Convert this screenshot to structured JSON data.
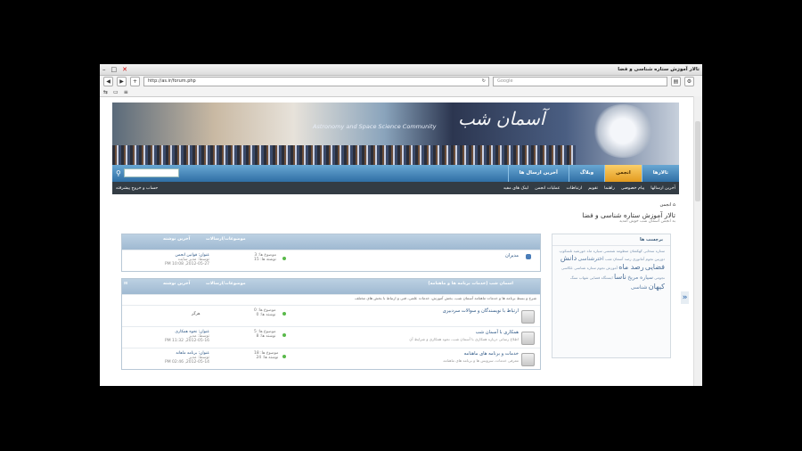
{
  "window": {
    "title": "تالار آموزش ستاره شناسی و فضا",
    "url": "http://as.ir/forum.php",
    "search_placeholder": "Google"
  },
  "banner": {
    "english_title": "Astronomy and Space Science Community",
    "logo_text": "آسمان شب"
  },
  "nav": {
    "tabs": [
      "تالارها",
      "انجمن",
      "وبلاگ",
      "آخرین ارسال ها"
    ],
    "active_tab": "انجمن",
    "submenu": [
      "آخرین ارسالها",
      "پیام خصوصی",
      "راهنما",
      "تقویم",
      "ارتباطات",
      "عملیات انجمن",
      "لینک های مفید"
    ],
    "login_label": "حساب و خروج پیشرفته"
  },
  "breadcrumb": {
    "home": "انجمن",
    "page_title": "تالار آموزش ستاره شناسی و فضا",
    "subtitle": "به انجمن آسمان شب خوش آمدید"
  },
  "section1": {
    "col_topics": "موضوعات/ارسالات",
    "col_last": "آخرین نوشته",
    "rows": [
      {
        "name": "مدیران",
        "stats": [
          "موضوع ها: 3",
          "نوشته ها: 15"
        ],
        "last": [
          "عنوان: قوانین انجمن",
          "توسط: مدیر سایت",
          "2012-05-27, 10:08 PM"
        ]
      }
    ]
  },
  "section2": {
    "title": "اسمان شب (خدمات برنامه ها و ماهنامه)",
    "col_topics": "موضوعات/ارسالات",
    "col_last": "آخرین نوشته",
    "note": "شرح و بسط برنامه ها و خدمات ماهنامه آسمان شب، بخش آموزش، خدمات علمی، فنی و ارتباط با بخش های مختلف",
    "rows": [
      {
        "name": "ارتباط با نویسندگان و سوالات سردبیری",
        "desc": "",
        "stats": [
          "موضوع ها: 0",
          "نوشته ها: 0"
        ],
        "last_plain": "هرگز"
      },
      {
        "name": "همکاری با آسمان شب",
        "desc": "اطلاع رسانی درباره همکاری با آسمان شب، نحوه همکاری و شرایط آن",
        "stats": [
          "موضوع ها: 5",
          "نوشته ها: 8"
        ],
        "last": [
          "عنوان: نحوه همکاری",
          "توسط: مدیر",
          "2012-05-16, 11:32 PM"
        ]
      },
      {
        "name": "خدمات و برنامه های ماهنامه",
        "desc": "معرفی خدمات، سرویس ها و برنامه های ماهنامه",
        "stats": [
          "موضوع ها: 18",
          "نوشته ها: 24"
        ],
        "last": [
          "عنوان: برنامه ماهانه",
          "توسط: مدیر",
          "2012-05-14, 02:46 PM"
        ]
      }
    ]
  },
  "tags": {
    "title": "برچسب ها",
    "small1": "ستاره سحابی کهکشان منظومه شمسی سیاره ماه خورشید تلسکوپ دوربین نجوم آماتوری رصد آسمان شب",
    "mid1": "اخترشناسی",
    "big1": "دانش فضایی",
    "big2": "رصد ماه",
    "small2": "آموزش نجوم ستاره شناسی عکاسی نجومی",
    "mid2": "سیاره مریخ",
    "big3": "ناسا",
    "small3": "ایستگاه فضایی شهاب سنگ",
    "big4": "کیهان",
    "mid3": "شناسی"
  }
}
